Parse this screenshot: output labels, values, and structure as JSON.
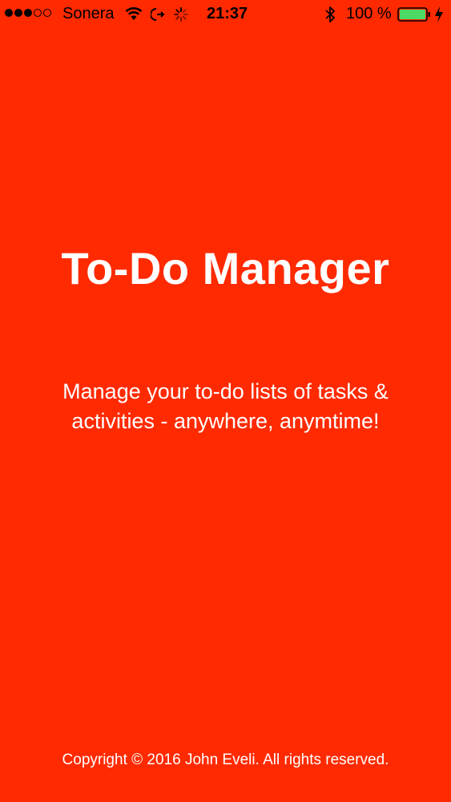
{
  "status_bar": {
    "signal_bars_filled": 3,
    "signal_bars_total": 5,
    "carrier": "Sonera",
    "time": "21:37",
    "battery_percent": "100 %",
    "icons": [
      "wifi-icon",
      "call-forward-icon",
      "loading-spinner-icon",
      "bluetooth-icon",
      "battery-icon",
      "charging-bolt-icon"
    ]
  },
  "splash": {
    "title": "To-Do Manager",
    "tagline": "Manage your to-do lists of tasks & activities - anywhere, anymtime!",
    "copyright": "Copyright © 2016 John Eveli. All rights reserved."
  },
  "colors": {
    "background": "#FF2A00",
    "text": "#FFFFFF",
    "battery_fill": "#4CD964"
  }
}
